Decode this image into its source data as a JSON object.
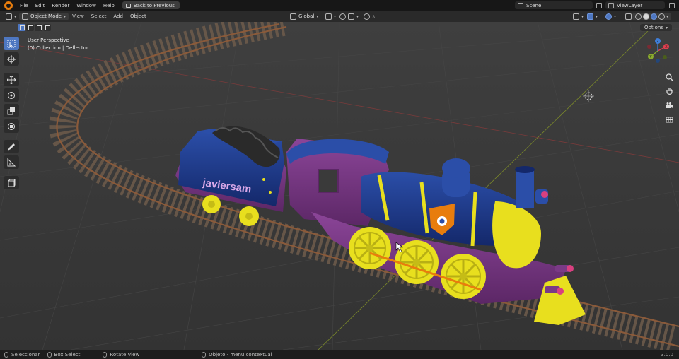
{
  "menubar": {
    "items": [
      "File",
      "Edit",
      "Render",
      "Window",
      "Help"
    ],
    "back_button": "Back to Previous",
    "scene_name": "Scene",
    "view_layer": "ViewLayer"
  },
  "viewport_header": {
    "mode": "Object Mode",
    "menus": [
      "View",
      "Select",
      "Add",
      "Object"
    ],
    "transform_orientation": "Global",
    "options_label": "Options"
  },
  "viewport": {
    "perspective_label": "User Perspective",
    "collection_label": "(0) Collection | Deflector",
    "tender_text": "javiersam",
    "colors": {
      "background": "#393939",
      "loco_blue": "#1e3a8c",
      "purple": "#7a3a86",
      "yellow": "#e8df1e",
      "orange": "#e87d0d",
      "coal": "#2a2a2a",
      "rail": "#8a5a3a"
    }
  },
  "toolbar": {
    "tools": [
      "select-box",
      "cursor",
      "move",
      "rotate",
      "scale",
      "transform",
      "annotate",
      "measure",
      "add-cube"
    ]
  },
  "navigation": [
    "zoom-icon",
    "pan-hand-icon",
    "camera-icon",
    "grid-view-icon"
  ],
  "gizmo": {
    "axes": [
      "X",
      "Y",
      "Z"
    ]
  },
  "statusbar": {
    "items": [
      "Seleccionar",
      "Box Select",
      "Rotate View",
      "Objeto - menú contextual"
    ],
    "version": "3.0.0"
  }
}
